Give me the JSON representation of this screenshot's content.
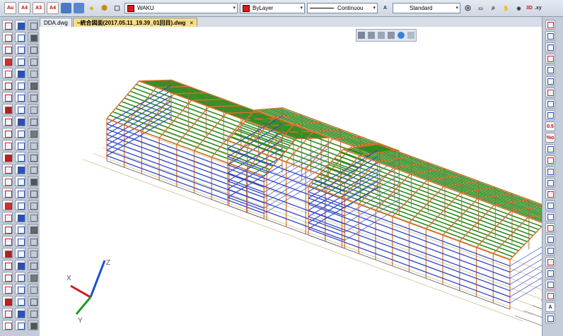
{
  "toolbar": {
    "layer_name": "WAKU",
    "color": "ByLayer",
    "linetype": "Continuou",
    "text_style": "Standard",
    "icon_labels": [
      "Au",
      "A4",
      "A3",
      "A4"
    ],
    "view_3d_label": "3D",
    "xy_label": ".xy"
  },
  "tabs": [
    {
      "label": "DDA.dwg"
    },
    {
      "label": "~統合図面(2017.05.11_19.39_01回目).dwg",
      "close": "×"
    }
  ],
  "right_palette": {
    "labels": [
      "0.5",
      "%o",
      "A"
    ]
  },
  "ucs": {
    "x": "X",
    "y": "Y",
    "z": "Z"
  },
  "colors": {
    "roof_purlin": "#2e8b1f",
    "rafter": "#d9712a",
    "wall_girt": "#2d46c8",
    "tab_active": "#f7dc87"
  },
  "icons": [
    "layer-manager-icon",
    "lightbulb-icon",
    "sun-icon",
    "color-swatch-icon",
    "linetype-icon",
    "text-style-icon",
    "orbit-icon",
    "zoom-icon",
    "pan-icon",
    "3d-view-icon"
  ]
}
